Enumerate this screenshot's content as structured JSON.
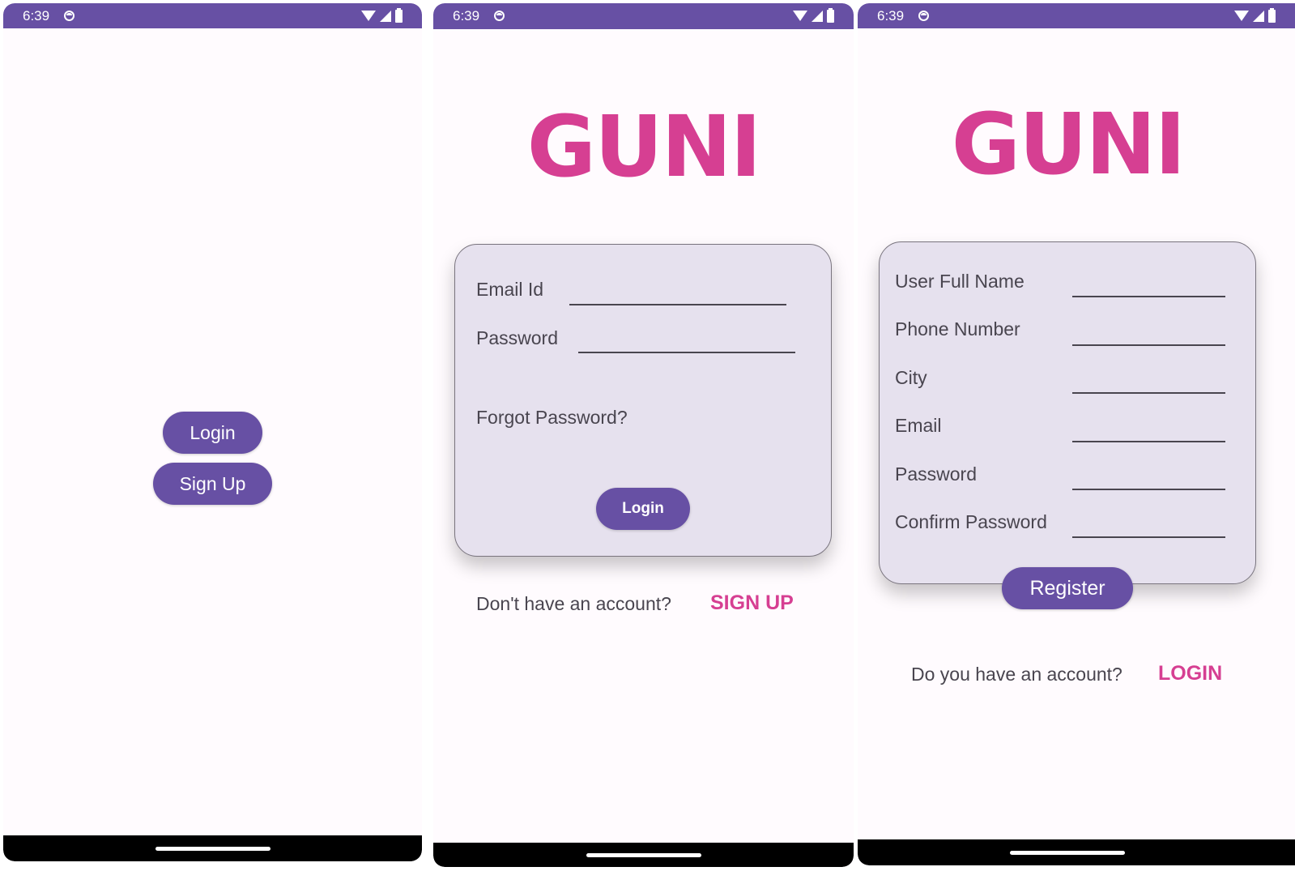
{
  "status_bar": {
    "time": "6:39"
  },
  "screen1": {
    "login_label": "Login",
    "signup_label": "Sign Up"
  },
  "screen2": {
    "logo": "GUNI",
    "email_label": "Email Id",
    "email_value": "",
    "password_label": "Password",
    "password_value": "",
    "forgot_password": "Forgot Password?",
    "login_label": "Login",
    "no_account_text": "Don't have an account?",
    "signup_link": "SIGN UP"
  },
  "screen3": {
    "logo": "GUNI",
    "fields": [
      {
        "label": "User Full Name",
        "value": ""
      },
      {
        "label": "Phone Number",
        "value": ""
      },
      {
        "label": "City",
        "value": ""
      },
      {
        "label": "Email",
        "value": ""
      },
      {
        "label": "Password",
        "value": ""
      },
      {
        "label": "Confirm Password",
        "value": ""
      }
    ],
    "register_label": "Register",
    "have_account_text": "Do you have an account?",
    "login_link": "LOGIN"
  },
  "colors": {
    "primary": "#6750a4",
    "accent": "#d63f92",
    "card_bg": "#e6e1ee",
    "screen_bg": "#fffbfe"
  },
  "icons": [
    "app-notification-icon",
    "wifi-icon",
    "signal-icon",
    "battery-icon",
    "home-indicator"
  ]
}
